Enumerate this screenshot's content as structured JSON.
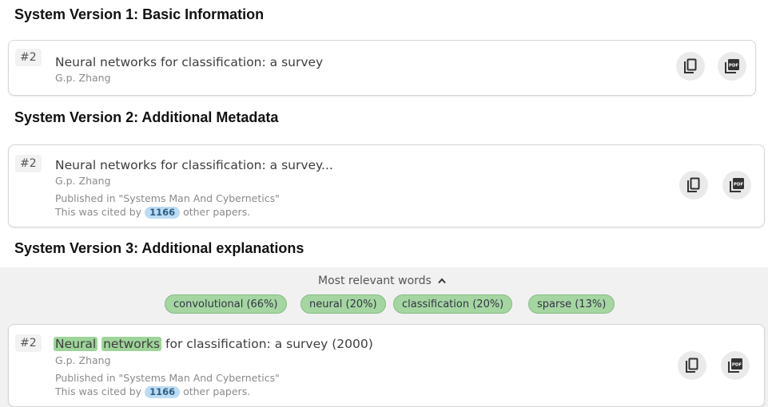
{
  "v1": {
    "heading": "System Version 1: Basic Information",
    "rank": "#2",
    "title": "Neural networks for classification: a survey",
    "authors": "G.p. Zhang"
  },
  "v2": {
    "heading": "System Version 2: Additional Metadata",
    "rank": "#2",
    "title": "Neural networks for classification: a survey...",
    "authors": "G.p. Zhang",
    "published": "Published in \"Systems Man And Cybernetics\"",
    "cited_prefix": "This was cited by",
    "cited_count": "1166",
    "cited_suffix": "other papers."
  },
  "v3": {
    "heading": "System Version 3: Additional explanations",
    "relevant_label": "Most relevant words",
    "chips": [
      "convolutional (66%)",
      "neural (20%)",
      "classification (20%)",
      "sparse (13%)"
    ],
    "rank": "#2",
    "title_hl1": "Neural",
    "title_hl2": "networks",
    "title_rest": "for classification: a survey (2000)",
    "authors": "G.p. Zhang",
    "published": "Published in \"Systems Man And Cybernetics\"",
    "cited_prefix": "This was cited by",
    "cited_count": "1166",
    "cited_suffix": "other papers."
  },
  "icons": [
    "copy-icon",
    "pdf-icon",
    "chevron-up-icon"
  ],
  "colors": {
    "highlight_green": "#9ed49a",
    "cite_blue": "#bcdcf3",
    "panel_gray": "#f1f1f1"
  }
}
